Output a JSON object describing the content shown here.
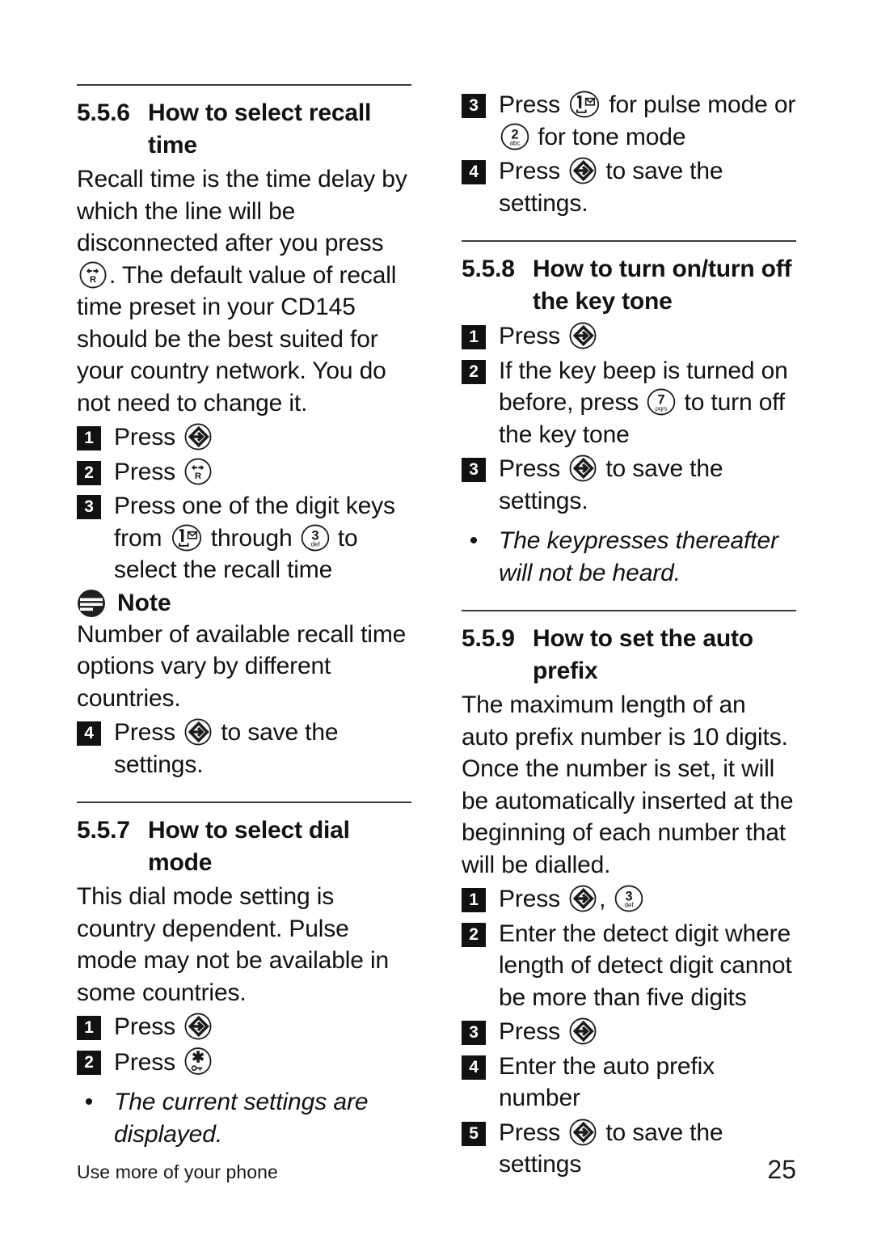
{
  "page": {
    "footer_left": "Use more of your phone",
    "page_number": "25"
  },
  "icons": {
    "menu_ok": "menu-ok-key-icon",
    "recall_r": "recall-r-key-icon",
    "key_1": "digit-1-voicemail-key-icon",
    "key_2": "digit-2-abc-key-icon",
    "key_3": "digit-3-def-key-icon",
    "key_7": "digit-7-pqrs-key-icon",
    "key_star": "star-lock-key-icon",
    "note": "note-icon"
  },
  "left_column": {
    "section_556": {
      "number": "5.5.6",
      "title": "How to select recall time",
      "intro_part1": "Recall time is the time delay by which the line will be disconnected after you press",
      "intro_part2": ". The default value of recall time preset in your CD145 should be the best suited for your country network. You do not need to change it.",
      "steps": [
        {
          "badge": "1",
          "text_before": "Press",
          "text_after": ""
        },
        {
          "badge": "2",
          "text_before": "Press",
          "text_after": ""
        },
        {
          "badge": "3",
          "text_before": "Press one of the digit keys from",
          "text_mid": "through",
          "text_after": "to select the recall time"
        }
      ],
      "note": {
        "title": "Note",
        "body": "Number of available recall time options vary by different countries."
      },
      "step4": {
        "badge": "4",
        "text_before": "Press",
        "text_after": "to save the settings."
      }
    },
    "section_557": {
      "number": "5.5.7",
      "title": "How to select dial mode",
      "intro": "This dial mode setting is country dependent.  Pulse mode may not be available in some countries.",
      "steps": [
        {
          "badge": "1",
          "text_before": "Press",
          "text_after": ""
        },
        {
          "badge": "2",
          "text_before": "Press",
          "text_after": ""
        }
      ],
      "bullet": "The current settings are displayed."
    }
  },
  "right_column": {
    "section_557_cont": {
      "steps": [
        {
          "badge": "3",
          "text_before": "Press",
          "text_mid": "for pulse mode or",
          "text_after": "for tone mode"
        },
        {
          "badge": "4",
          "text_before": "Press",
          "text_after": "to save the settings."
        }
      ]
    },
    "section_558": {
      "number": "5.5.8",
      "title": "How to turn on/turn off the key tone",
      "steps": [
        {
          "badge": "1",
          "text_before": "Press",
          "text_after": ""
        },
        {
          "badge": "2",
          "text_before": "If the key beep is turned on before, press",
          "text_after": "to turn off the key tone"
        },
        {
          "badge": "3",
          "text_before": "Press",
          "text_after": "to save the settings."
        }
      ],
      "bullet": "The keypresses thereafter will not be heard."
    },
    "section_559": {
      "number": "5.5.9",
      "title": "How to set the auto prefix",
      "intro": "The maximum length of an auto prefix number is 10 digits. Once the number is set, it will be automatically inserted at the beginning of each number that will be dialled.",
      "steps": [
        {
          "badge": "1",
          "text_before": "Press",
          "text_mid": ",",
          "text_after": ""
        },
        {
          "badge": "2",
          "text_before": "Enter the detect digit where length of detect digit cannot be more than five digits",
          "text_after": ""
        },
        {
          "badge": "3",
          "text_before": "Press",
          "text_after": ""
        },
        {
          "badge": "4",
          "text_before": "Enter the auto prefix number",
          "text_after": ""
        },
        {
          "badge": "5",
          "text_before": "Press",
          "text_after": "to save the settings"
        }
      ]
    }
  }
}
